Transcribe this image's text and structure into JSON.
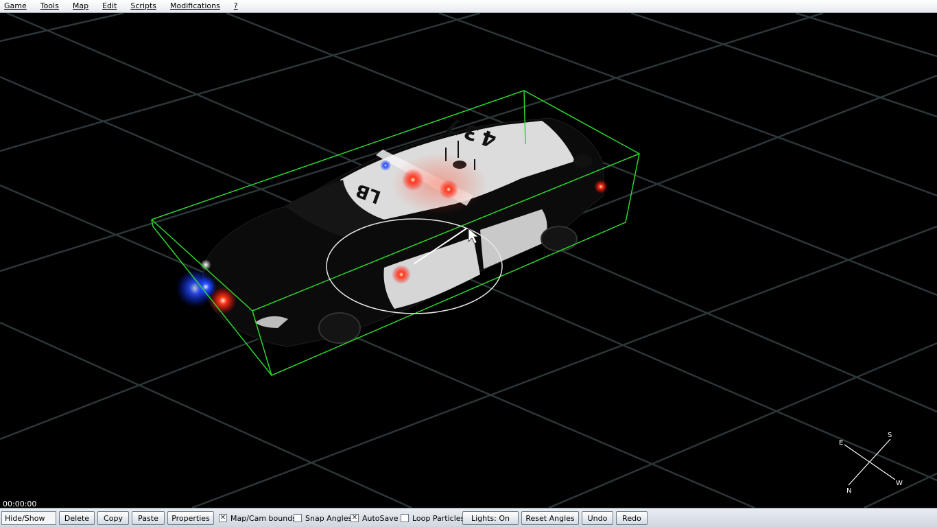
{
  "menu": {
    "items": [
      "Game",
      "Tools",
      "Map",
      "Edit",
      "Scripts",
      "Modifications",
      "?"
    ]
  },
  "viewport": {
    "timer": "00:00:00",
    "car_text": {
      "plate": "LB",
      "number": "437"
    },
    "compass": {
      "n": "N",
      "e": "E",
      "s": "S",
      "w": "W"
    }
  },
  "toolbar": {
    "hide_show": "Hide/Show",
    "delete": "Delete",
    "copy": "Copy",
    "paste": "Paste",
    "properties": "Properties",
    "map_cam_bounds": {
      "label": "Map/Cam bounds",
      "checked": true
    },
    "snap_angles": {
      "label": "Snap Angles",
      "checked": false
    },
    "autosave": {
      "label": "AutoSave",
      "checked": true
    },
    "loop_particles": {
      "label": "Loop Particles",
      "checked": false
    },
    "lights": "Lights: On",
    "reset_angles": "Reset Angles",
    "undo": "Undo",
    "redo": "Redo"
  },
  "colors": {
    "grid": "#2f3a3c",
    "bounding_box": "#2fd12f",
    "light_red": "#ff2a1a",
    "light_blue": "#2a4dff"
  }
}
